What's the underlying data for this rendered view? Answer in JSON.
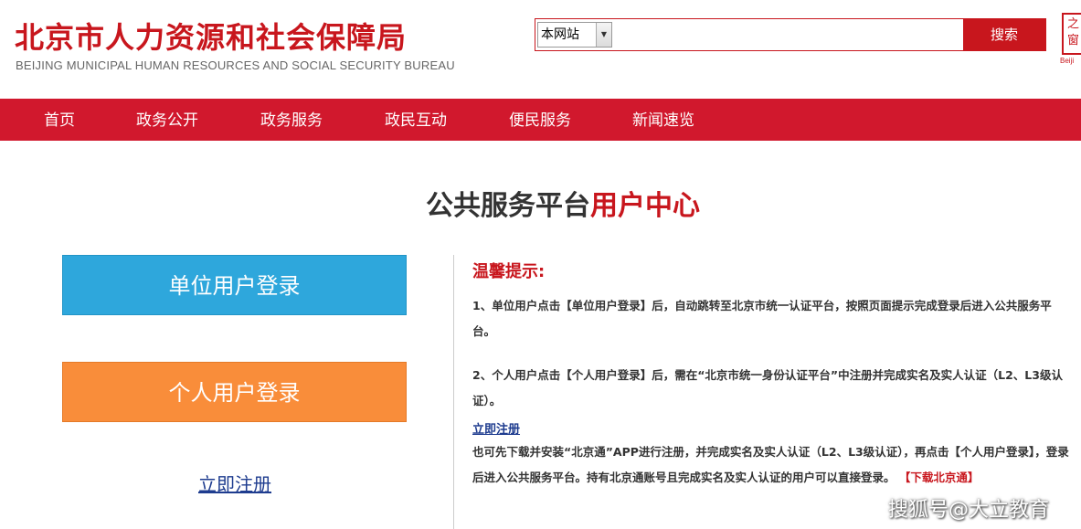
{
  "header": {
    "title": "北京市人力资源和社会保障局",
    "subtitle": "BEIJING MUNICIPAL HUMAN RESOURCES AND SOCIAL SECURITY BUREAU",
    "logo_glyph": "之窗",
    "logo_caption": "Beiji"
  },
  "search": {
    "scope_selected": "本网站",
    "query": "",
    "button_label": "搜索"
  },
  "nav": {
    "items": [
      {
        "label": "首页"
      },
      {
        "label": "政务公开"
      },
      {
        "label": "政务服务"
      },
      {
        "label": "政民互动"
      },
      {
        "label": "便民服务"
      },
      {
        "label": "新闻速览"
      }
    ]
  },
  "page": {
    "title_main": "公共服务平台",
    "title_highlight": "用户中心"
  },
  "login": {
    "org_label": "单位用户登录",
    "person_label": "个人用户登录",
    "register_label": "立即注册"
  },
  "tips": {
    "title": "温馨提示:",
    "tip1": "1、单位用户点击【单位用户登录】后，自动跳转至北京市统一认证平台，按照页面提示完成登录后进入公共服务平台。",
    "tip2": "2、个人用户点击【个人用户登录】后，需在“北京市统一身份认证平台”中注册并完成实名及实人认证（L2、L3级认证）。",
    "register_link": "立即注册",
    "tip3": "也可先下载并安装“北京通”APP进行注册，并完成实名及实人认证（L2、L3级认证），再点击【个人用户登录】，登录后进入公共服务平台。持有北京通账号且完成实名及实人认证的用户可以直接登录。",
    "download_link": "【下载北京通】"
  },
  "watermark": "搜狐号@大立教育",
  "colors": {
    "brand_red": "#c8161d",
    "nav_red": "#d1182d",
    "org_button": "#2ea7dc",
    "person_button": "#f98d3a",
    "link_blue": "#1e3c8f"
  }
}
